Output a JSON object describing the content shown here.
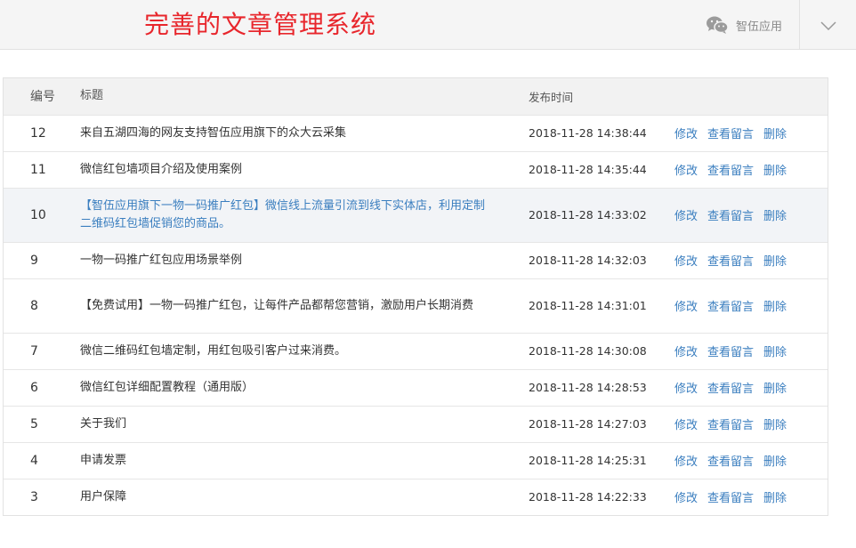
{
  "header": {
    "title": "完善的文章管理系统",
    "brand_label": "智伍应用",
    "colors": {
      "title": "#e8262c",
      "link": "#3a7ebf",
      "header_bg": "#f5f5f5"
    }
  },
  "table": {
    "columns": {
      "id": "编号",
      "title": "标题",
      "time": "发布时间"
    },
    "actions": {
      "edit": "修改",
      "comments": "查看留言",
      "delete": "删除"
    },
    "rows": [
      {
        "id": "12",
        "title": "来自五湖四海的网友支持智伍应用旗下的众大云采集",
        "time": "2018-11-28 14:38:44"
      },
      {
        "id": "11",
        "title": "微信红包墙项目介绍及使用案例",
        "time": "2018-11-28 14:35:44"
      },
      {
        "id": "10",
        "title": "【智伍应用旗下一物一码推广红包】微信线上流量引流到线下实体店，利用定制二维码红包墙促销您的商品。",
        "time": "2018-11-28 14:33:02"
      },
      {
        "id": "9",
        "title": "一物一码推广红包应用场景举例",
        "time": "2018-11-28 14:32:03"
      },
      {
        "id": "8",
        "title": "【免费试用】一物一码推广红包，让每件产品都帮您营销，激励用户长期消费",
        "time": "2018-11-28 14:31:01"
      },
      {
        "id": "7",
        "title": "微信二维码红包墙定制，用红包吸引客户过来消费。",
        "time": "2018-11-28 14:30:08"
      },
      {
        "id": "6",
        "title": "微信红包详细配置教程（通用版）",
        "time": "2018-11-28 14:28:53"
      },
      {
        "id": "5",
        "title": "关于我们",
        "time": "2018-11-28 14:27:03"
      },
      {
        "id": "4",
        "title": "申请发票",
        "time": "2018-11-28 14:25:31"
      },
      {
        "id": "3",
        "title": "用户保障",
        "time": "2018-11-28 14:22:33"
      }
    ]
  }
}
